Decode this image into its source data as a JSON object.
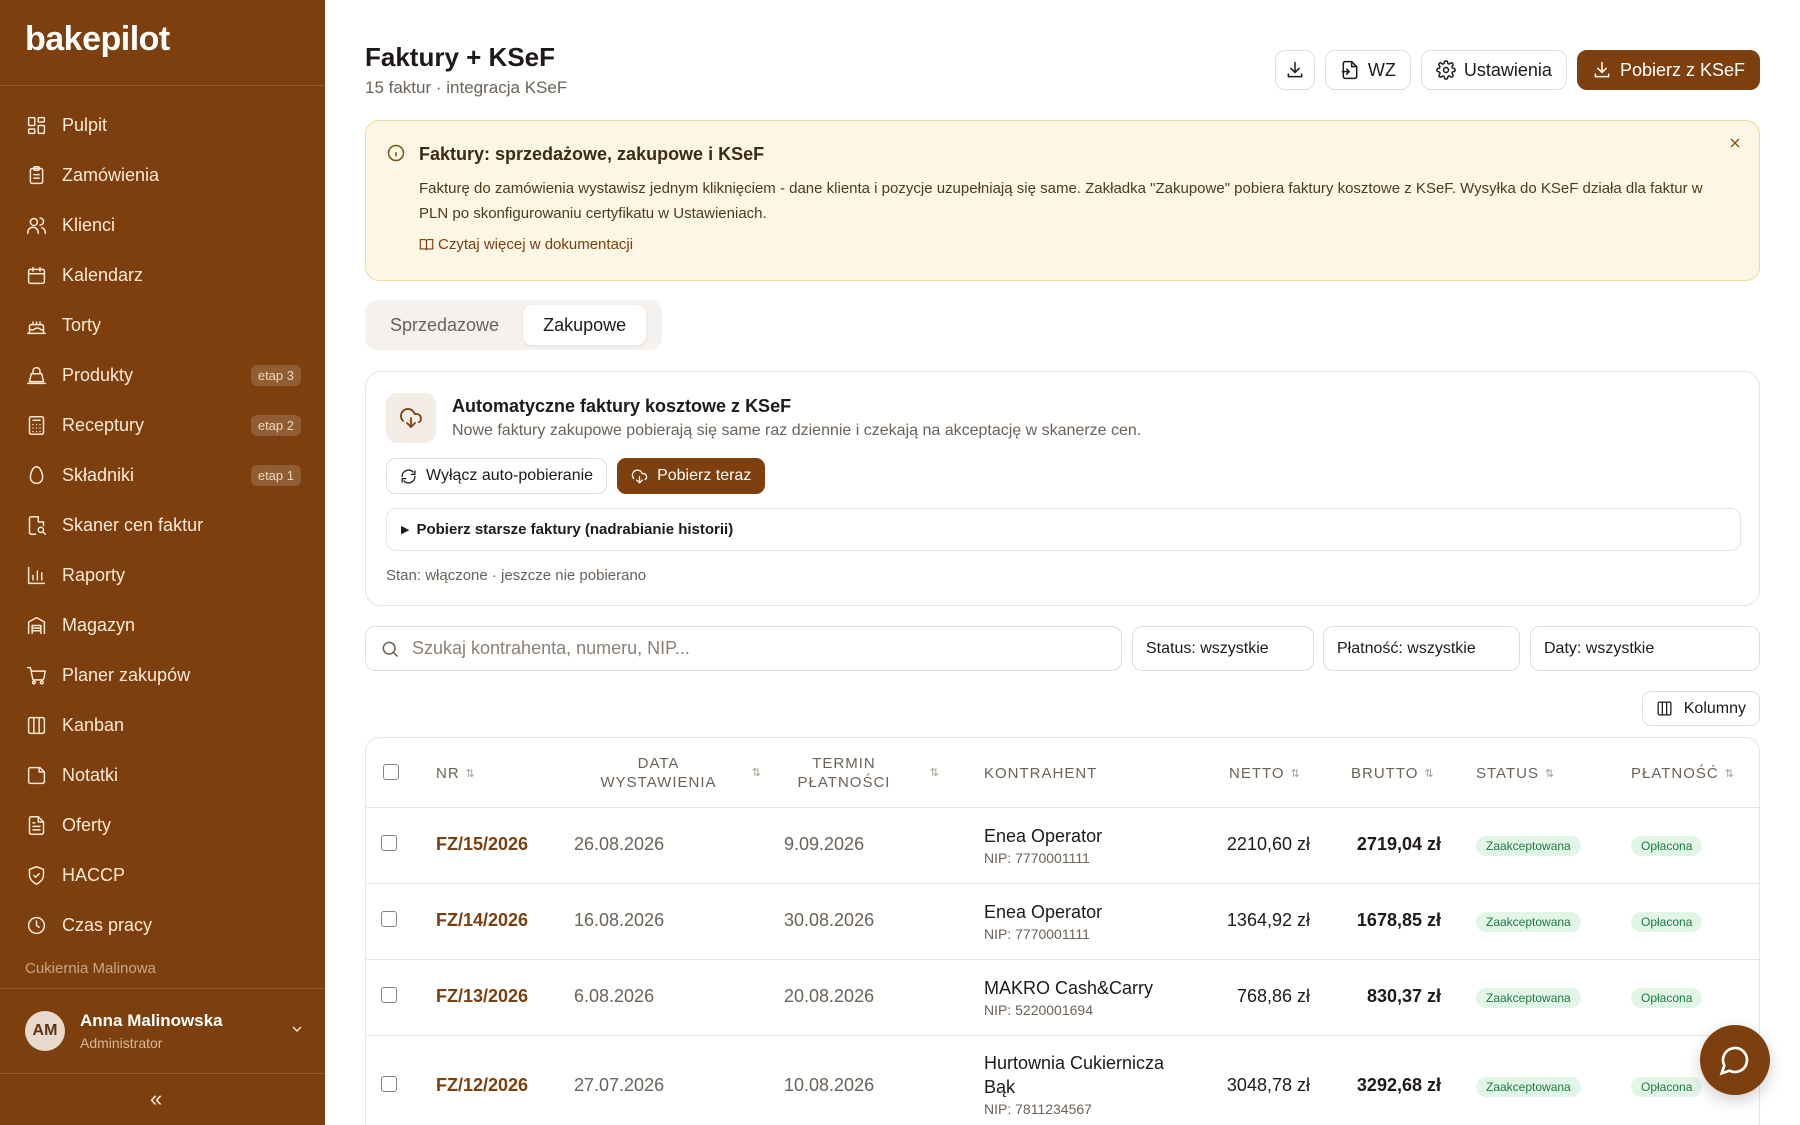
{
  "app": {
    "logo": "bakepilot"
  },
  "sidebar": {
    "items": [
      {
        "label": "Pulpit",
        "icon": "dashboard-icon",
        "badge": ""
      },
      {
        "label": "Zamówienia",
        "icon": "clipboard-icon",
        "badge": ""
      },
      {
        "label": "Klienci",
        "icon": "users-icon",
        "badge": ""
      },
      {
        "label": "Kalendarz",
        "icon": "calendar-icon",
        "badge": ""
      },
      {
        "label": "Torty",
        "icon": "cake-icon",
        "badge": ""
      },
      {
        "label": "Produkty",
        "icon": "croissant-icon",
        "badge": "etap 3"
      },
      {
        "label": "Receptury",
        "icon": "calculator-icon",
        "badge": "etap 2"
      },
      {
        "label": "Składniki",
        "icon": "egg-icon",
        "badge": "etap 1"
      },
      {
        "label": "Skaner cen faktur",
        "icon": "file-scan-icon",
        "badge": ""
      },
      {
        "label": "Raporty",
        "icon": "bar-chart-icon",
        "badge": ""
      },
      {
        "label": "Magazyn",
        "icon": "warehouse-icon",
        "badge": ""
      },
      {
        "label": "Planer zakupów",
        "icon": "cart-icon",
        "badge": ""
      },
      {
        "label": "Kanban",
        "icon": "kanban-icon",
        "badge": ""
      },
      {
        "label": "Notatki",
        "icon": "note-icon",
        "badge": ""
      },
      {
        "label": "Oferty",
        "icon": "document-icon",
        "badge": ""
      },
      {
        "label": "HACCP",
        "icon": "shield-icon",
        "badge": ""
      },
      {
        "label": "Czas pracy",
        "icon": "clock-icon",
        "badge": ""
      }
    ],
    "org_name": "Cukiernia Malinowa",
    "user": {
      "initials": "AM",
      "name": "Anna Malinowska",
      "role": "Administrator"
    },
    "collapse_label": "«"
  },
  "header": {
    "title": "Faktury + KSeF",
    "subtitle": "15 faktur · integracja KSeF",
    "buttons": {
      "wz": "WZ",
      "settings": "Ustawienia",
      "fetch": "Pobierz z KSeF"
    }
  },
  "notice": {
    "title": "Faktury: sprzedażowe, zakupowe i KSeF",
    "body": "Fakturę do zamówienia wystawisz jednym kliknięciem - dane klienta i pozycje uzupełniają się same. Zakładka \"Zakupowe\" pobiera faktury kosztowe z KSeF. Wysyłka do KSeF działa dla faktur w PLN po skonfigurowaniu certyfikatu w Ustawieniach.",
    "link": "Czytaj więcej w dokumentacji"
  },
  "tabs": {
    "sales": "Sprzedazowe",
    "purchase": "Zakupowe"
  },
  "auto_card": {
    "title": "Automatyczne faktury kosztowe z KSeF",
    "description": "Nowe faktury zakupowe pobierają się same raz dziennie i czekają na akceptację w skanerze cen.",
    "toggle_button": "Wyłącz auto-pobieranie",
    "fetch_now_button": "Pobierz teraz",
    "history_label": "Pobierz starsze faktury (nadrabianie historii)",
    "status": "Stan: włączone · jeszcze nie pobierano"
  },
  "filters": {
    "search_placeholder": "Szukaj kontrahenta, numeru, NIP...",
    "status": "Status: wszystkie",
    "payment": "Płatność: wszystkie",
    "dates": "Daty: wszystkie",
    "columns_button": "Kolumny"
  },
  "table": {
    "headers": {
      "nr": "NR",
      "issue_date_1": "DATA",
      "issue_date_2": "WYSTAWIENIA",
      "due_1": "TERMIN",
      "due_2": "PŁATNOŚCI",
      "contractor": "KONTRAHENT",
      "net": "NETTO",
      "gross": "BRUTTO",
      "status": "STATUS",
      "payment": "PŁATNOŚĆ"
    },
    "rows": [
      {
        "nr": "FZ/15/2026",
        "issue": "26.08.2026",
        "due": "9.09.2026",
        "name_1": "Enea Operator",
        "name_2": "",
        "nip": "NIP: 7770001111",
        "net": "2210,60 zł",
        "gross": "2719,04 zł",
        "status": "Zaakceptowana",
        "payment": "Opłacona"
      },
      {
        "nr": "FZ/14/2026",
        "issue": "16.08.2026",
        "due": "30.08.2026",
        "name_1": "Enea Operator",
        "name_2": "",
        "nip": "NIP: 7770001111",
        "net": "1364,92 zł",
        "gross": "1678,85 zł",
        "status": "Zaakceptowana",
        "payment": "Opłacona"
      },
      {
        "nr": "FZ/13/2026",
        "issue": "6.08.2026",
        "due": "20.08.2026",
        "name_1": "MAKRO Cash&Carry",
        "name_2": "",
        "nip": "NIP: 5220001694",
        "net": "768,86 zł",
        "gross": "830,37 zł",
        "status": "Zaakceptowana",
        "payment": "Opłacona"
      },
      {
        "nr": "FZ/12/2026",
        "issue": "27.07.2026",
        "due": "10.08.2026",
        "name_1": "Hurtownia Cukiernicza",
        "name_2": "Bąk",
        "nip": "NIP: 7811234567",
        "net": "3048,78 zł",
        "gross": "3292,68 zł",
        "status": "Zaakceptowana",
        "payment": "Opłacona"
      }
    ]
  },
  "colors": {
    "brand": "#7d3f0d",
    "notice_bg": "#fdf6e4",
    "pill_bg": "#e2f6e8",
    "pill_text": "#1e7a3e"
  }
}
